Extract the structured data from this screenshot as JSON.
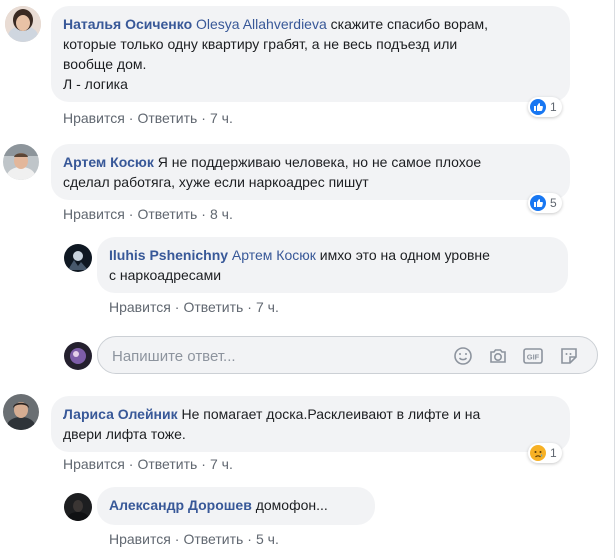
{
  "actions": {
    "like": "Нравится",
    "reply": "Ответить",
    "dot": "·"
  },
  "comments": [
    {
      "author": "Наталья Осиченко",
      "mention": "Olesya Allahverdieva",
      "lines": [
        "скажите спасибо ворам,",
        "которые только одну квартиру грабят, а не весь подъезд или",
        "вообще дом.",
        "Л - логика"
      ],
      "time": "7 ч.",
      "reaction": {
        "type": "like-icon",
        "count": "1"
      }
    },
    {
      "author": "Артем Косюк",
      "lines": [
        "Я не поддерживаю человека, но не самое плохое",
        "сделал работяга, хуже если наркоадрес пишут"
      ],
      "time": "8 ч.",
      "reaction": {
        "type": "like-icon",
        "count": "5"
      },
      "replies": [
        {
          "author": "Iluhis Pshenichny",
          "mention": "Артем Косюк",
          "lines": [
            "имхо это на одном уровне",
            "с наркоадресами"
          ],
          "time": "7 ч."
        }
      ]
    },
    {
      "author": "Лариса Олейник",
      "lines": [
        "Не помагает доска.Расклеивают в лифте и на",
        "двери лифта тоже."
      ],
      "time": "7 ч.",
      "reaction": {
        "type": "sad-icon",
        "count": "1"
      },
      "replies": [
        {
          "author": "Александр Дорошев",
          "lines": [
            "домофон..."
          ],
          "time": "5 ч."
        }
      ]
    }
  ],
  "composer": {
    "placeholder": "Напишите ответ..."
  },
  "colors": {
    "link": "#385898",
    "bubble": "#f2f3f5",
    "like": "#1877f2",
    "sad": "#f7b125"
  }
}
